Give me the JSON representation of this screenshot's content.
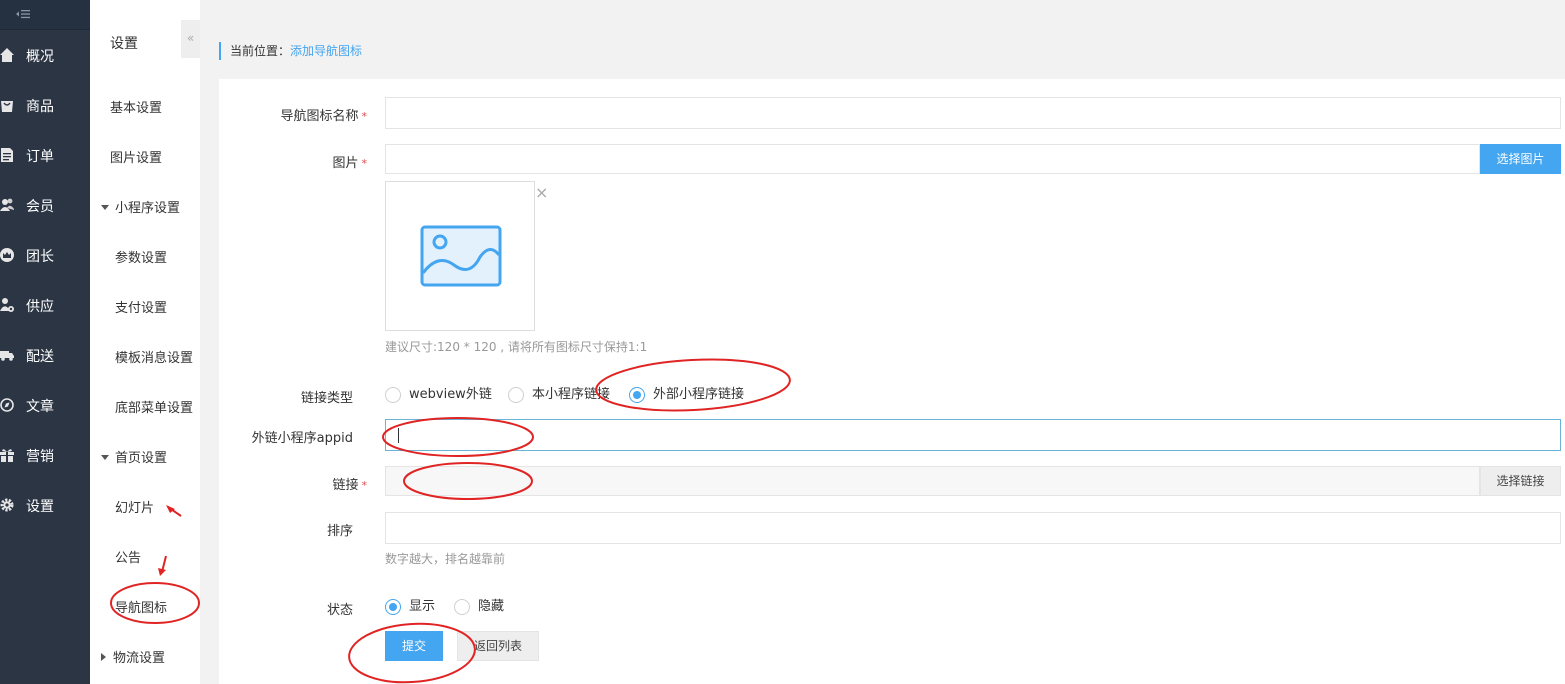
{
  "nav": {
    "items": [
      {
        "label": "概况",
        "icon": "home-icon"
      },
      {
        "label": "商品",
        "icon": "bag-icon"
      },
      {
        "label": "订单",
        "icon": "document-icon"
      },
      {
        "label": "会员",
        "icon": "users-icon"
      },
      {
        "label": "团长",
        "icon": "crown-icon"
      },
      {
        "label": "供应",
        "icon": "supplier-icon"
      },
      {
        "label": "配送",
        "icon": "truck-icon"
      },
      {
        "label": "文章",
        "icon": "compass-icon"
      },
      {
        "label": "营销",
        "icon": "gift-icon"
      },
      {
        "label": "设置",
        "icon": "gear-icon"
      }
    ]
  },
  "sub": {
    "title": "设置",
    "collapse": "«",
    "items": {
      "basic": "基本设置",
      "image": "图片设置",
      "miniprogram": "小程序设置",
      "params": "参数设置",
      "payment": "支付设置",
      "template_msg": "模板消息设置",
      "bottom_menu": "底部菜单设置",
      "homepage": "首页设置",
      "slides": "幻灯片",
      "notice": "公告",
      "nav_icon": "导航图标",
      "logistics": "物流设置"
    }
  },
  "breadcrumb": {
    "prefix": "当前位置：",
    "current": "添加导航图标"
  },
  "form": {
    "name_label": "导航图标名称",
    "name_value": "",
    "image_label": "图片",
    "image_value": "",
    "choose_image": "选择图片",
    "close_icon": "×",
    "image_hint": "建议尺寸:120 * 120 , 请将所有图标尺寸保持1:1",
    "link_type_label": "链接类型",
    "link_types": [
      "webview外链",
      "本小程序链接",
      "外部小程序链接"
    ],
    "link_type_selected": 2,
    "appid_label": "外链小程序appid",
    "appid_value": "",
    "link_label": "链接",
    "link_value": "",
    "choose_link": "选择链接",
    "sort_label": "排序",
    "sort_value": "",
    "sort_hint": "数字越大，排名越靠前",
    "status_label": "状态",
    "status_options": [
      "显示",
      "隐藏"
    ],
    "status_selected": 0,
    "required_mark": "*",
    "submit": "提交",
    "back": "返回列表"
  },
  "colors": {
    "nav_bg": "#2b3544",
    "accent": "#44a5f0",
    "annotation": "#e02424"
  }
}
